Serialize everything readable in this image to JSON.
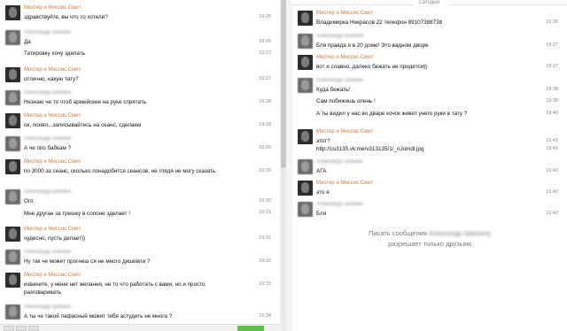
{
  "left": {
    "messages": [
      {
        "author": "Мистер и Миссис Смит",
        "author_blur": false,
        "lines": [
          "здравствуйте, вы что то хотели?"
        ],
        "times": [
          "19:25"
        ]
      },
      {
        "author": "Александр Шапкин",
        "author_blur": true,
        "lines": [
          "Да",
          "Татировку хочу зделать"
        ],
        "times": [
          "19:26",
          "19:27"
        ]
      },
      {
        "author": "Мистер и Миссис Смит",
        "author_blur": false,
        "lines": [
          "отлично, какую тату?"
        ],
        "times": [
          "19:27"
        ]
      },
      {
        "author": "Александр Шапкин",
        "author_blur": true,
        "lines": [
          "Незнаю че то чтоб армейские на руке спрятать"
        ],
        "times": [
          "19:28"
        ]
      },
      {
        "author": "Мистер и Миссис Смит",
        "author_blur": false,
        "lines": [
          "ок, понял...записывайтесь на сеанс, сделаем"
        ],
        "times": [
          "19:28"
        ]
      },
      {
        "author": "Александр Шапкин",
        "author_blur": true,
        "lines": [
          "А че ппо бабкам ?"
        ],
        "times": [
          "19:29"
        ]
      },
      {
        "author": "Мистер и Миссис Смит",
        "author_blur": false,
        "lines": [
          "по 3000 за сеанс, сколько понадобится сеансов, не глядя не могу сказать"
        ],
        "times": [
          "19:29"
        ]
      },
      {
        "author": "Александр Шапкин",
        "author_blur": true,
        "lines": [
          "Ого",
          "Мне друган за трешку в сопоне зделает !"
        ],
        "times": [
          "19:30",
          "19:31"
        ]
      },
      {
        "author": "Мистер и Миссис Смит",
        "author_blur": false,
        "lines": [
          "чудесно, пусть делает))"
        ],
        "times": [
          "19:31"
        ]
      },
      {
        "author": "Александр Шапкин",
        "author_blur": true,
        "lines": [
          "Ну так че может прогнеш ся не много дишевли ?"
        ],
        "times": [
          "19:32"
        ]
      },
      {
        "author": "Мистер и Миссис Смит",
        "author_blur": false,
        "lines": [
          "извините, у меня нет желания, не то что работать с вами, но и просто разговаривать"
        ],
        "times": [
          "19:33"
        ]
      },
      {
        "author": "Александр Шапкин",
        "author_blur": true,
        "lines": [
          "А ты че такой пафасный можит тебя астудить не многа ?"
        ],
        "times": [
          "19:34"
        ]
      }
    ]
  },
  "right": {
    "date_label": "Сегодня",
    "messages": [
      {
        "author": "Мистер и Миссис Смит",
        "author_blur": false,
        "lines": [
          "Владимирка Некрасов 22 телефон 89107388738"
        ],
        "times": [
          "19:35"
        ]
      },
      {
        "author": "Александр Шапкин",
        "author_blur": true,
        "lines": [
          "Бля правда я в 20 доме! Это вадном дворе"
        ],
        "times": [
          "19:37"
        ]
      },
      {
        "author": "Мистер и Миссис Смит",
        "author_blur": false,
        "lines": [
          "вот и славно, далеко бежать не придется))"
        ],
        "times": [
          "19:37"
        ]
      },
      {
        "author": "Александр Шапкин",
        "author_blur": true,
        "lines": [
          "Куда бежать!",
          "Сам побижишь опень !",
          "А ты видил у нас во дваре кочок живет унего руки в тату ?"
        ],
        "times": [
          "19:38",
          "19:38",
          "19:40"
        ]
      },
      {
        "author": "Мистер и Миссис Смит",
        "author_blur": false,
        "lines": [
          "этот?",
          "http://cs3135.vk.me/v313135/1/_nJomdl.jpg"
        ],
        "times": [
          "19:41",
          "19:41"
        ]
      },
      {
        "author": "Александр Шапкин",
        "author_blur": true,
        "lines": [
          "АГА"
        ],
        "times": [
          "19:42"
        ]
      },
      {
        "author": "Мистер и Миссис Смит",
        "author_blur": false,
        "lines": [
          "это я"
        ],
        "times": [
          "19:42"
        ]
      },
      {
        "author": "Александр Шапкин",
        "author_blur": true,
        "lines": [
          "Бля"
        ],
        "times": [
          "19:42"
        ]
      }
    ],
    "notice_prefix": "Писать сообщения",
    "notice_name": "Александр Шапкину",
    "notice_suffix": "разрешает только друзьям"
  }
}
